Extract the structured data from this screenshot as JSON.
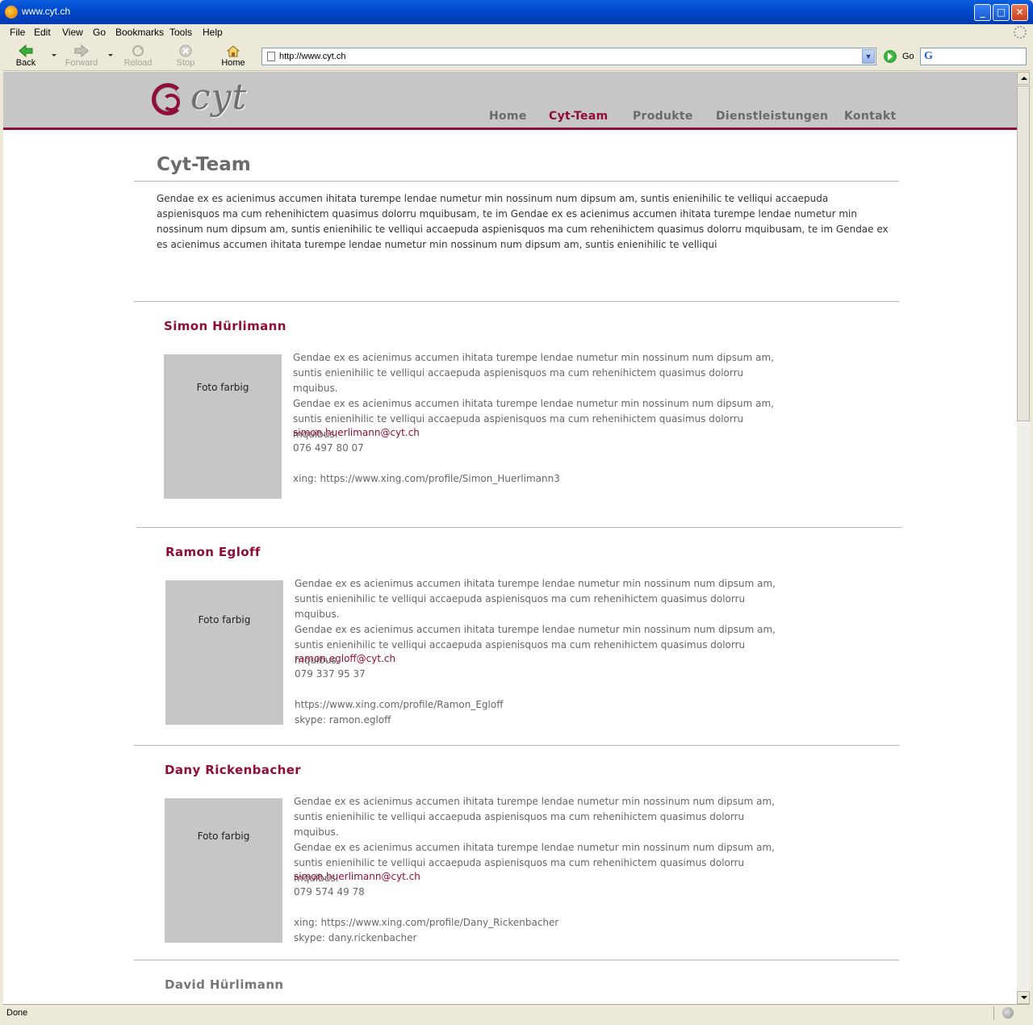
{
  "window": {
    "title": "www.cyt.ch"
  },
  "menu": [
    "File",
    "Edit",
    "View",
    "Go",
    "Bookmarks",
    "Tools",
    "Help"
  ],
  "nav": {
    "back": "Back",
    "forward": "Forward",
    "reload": "Reload",
    "stop": "Stop",
    "home": "Home",
    "go": "Go"
  },
  "url": "http://www.cyt.ch",
  "status": "Done",
  "site": {
    "logo": "cyt",
    "nav": [
      "Home",
      "Cyt-Team",
      "Produkte",
      "Dienstleistungen",
      "Kontakt"
    ],
    "active_nav": "Cyt-Team",
    "title": "Cyt-Team",
    "intro": "Gendae ex es acienimus accumen ihitata turempe lendae numetur min nossinum num dipsum am, suntis enienihilic te velliqui accaepuda aspienisquos ma cum rehenihictem quasimus dolorru mquibusam, te im Gendae ex es acienimus accumen ihitata turempe lendae numetur min nossinum num dipsum am, suntis enienihilic te velliqui accaepuda aspienisquos ma cum rehenihictem quasimus dolorru mquibusam, te im Gendae ex es acienimus accumen ihitata turempe lendae numetur min nossinum num dipsum am, suntis enienihilic te velliqui",
    "photo_label": "Foto farbig",
    "bio_lines": [
      "Gendae ex es acienimus accumen ihitata turempe lendae numetur min nossinum num dipsum am,",
      "suntis enienihilic te velliqui accaepuda aspienisquos ma cum rehenihictem quasimus dolorru mquibus.",
      "Gendae ex es acienimus accumen ihitata turempe lendae numetur min nossinum num dipsum am,",
      "suntis enienihilic te velliqui accaepuda aspienisquos ma cum rehenihictem quasimus dolorru mquibus."
    ],
    "members": [
      {
        "name": "Simon Hürlimann",
        "email": "simon.huerlimann@cyt.ch",
        "phone": "076 497 80 07",
        "xing": "xing: https://www.xing.com/profile/Simon_Huerlimann3",
        "skype": ""
      },
      {
        "name": "Ramon Egloff",
        "email": "ramon.egloff@cyt.ch",
        "phone": "079 337 95 37",
        "xing": "https://www.xing.com/profile/Ramon_Egloff",
        "skype": "skype: ramon.egloff"
      },
      {
        "name": "Dany Rickenbacher",
        "email": "simon.huerlimann@cyt.ch",
        "phone": "079 574 49 78",
        "xing": "xing: https://www.xing.com/profile/Dany_Rickenbacher",
        "skype": "skype: dany.rickenbacher"
      },
      {
        "name": "David Hürlimann"
      }
    ]
  }
}
